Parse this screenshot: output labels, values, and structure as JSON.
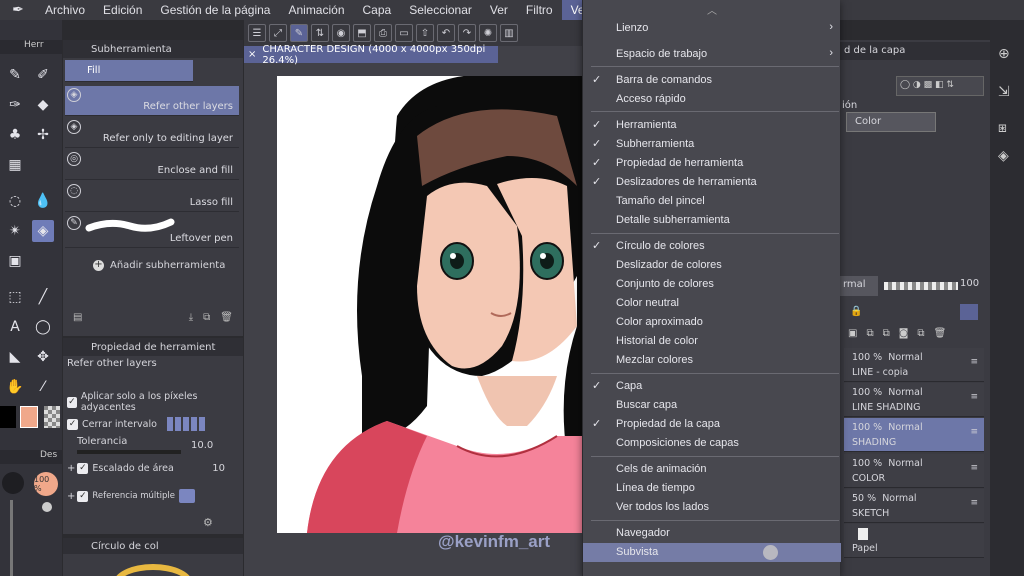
{
  "menubar": {
    "items": [
      "Archivo",
      "Edición",
      "Gestión de la página",
      "Animación",
      "Capa",
      "Seleccionar",
      "Ver",
      "Filtro",
      "Ventana"
    ]
  },
  "document_tab": "CHARACTER DESIGN (4000 x 4000px 350dpi 26.4%)",
  "subtool_panel": {
    "title": "Subherramienta",
    "items": [
      "Fill",
      "Refer other layers",
      "Refer only to editing layer",
      "Enclose and fill",
      "Lasso fill",
      "Leftover pen"
    ],
    "add_label": "Añadir subherramienta"
  },
  "tool_property": {
    "title": "Propiedad de herramient",
    "subtitle": "Refer other layers",
    "options": [
      "Aplicar solo a los píxeles adyacentes",
      "Cerrar intervalo"
    ],
    "tolerance_label": "Tolerancia",
    "tolerance_value": "10.0",
    "area_label": "Escalado de área",
    "area_value": "10",
    "multi_ref_label": "Referencia múltiple"
  },
  "color_panel_title": "Círculo de col",
  "zoom_badge": "100 %",
  "left_tab": "Herr",
  "left_tab2": "Des",
  "watermark": "@kevinfm_art",
  "window_menu": {
    "items": [
      {
        "label": "Lienzo",
        "arrow": "›"
      },
      {
        "label": "Espacio de trabajo",
        "arrow": "›"
      },
      {
        "label": "Barra de comandos",
        "check": true
      },
      {
        "label": "Acceso rápido"
      },
      {
        "label": "Herramienta",
        "check": true
      },
      {
        "label": "Subherramienta",
        "check": true
      },
      {
        "label": "Propiedad de herramienta",
        "check": true
      },
      {
        "label": "Deslizadores de herramienta",
        "check": true
      },
      {
        "label": "Tamaño del pincel"
      },
      {
        "label": "Detalle subherramienta"
      },
      {
        "label": "Círculo de colores",
        "check": true
      },
      {
        "label": "Deslizador de colores"
      },
      {
        "label": "Conjunto de colores"
      },
      {
        "label": "Color neutral"
      },
      {
        "label": "Color aproximado"
      },
      {
        "label": "Historial de color"
      },
      {
        "label": "Mezclar colores"
      },
      {
        "label": "Capa",
        "check": true
      },
      {
        "label": "Buscar capa"
      },
      {
        "label": "Propiedad de la capa",
        "check": true
      },
      {
        "label": "Composiciones de capas"
      },
      {
        "label": "Cels de animación"
      },
      {
        "label": "Línea de tiempo"
      },
      {
        "label": "Ver todos los lados"
      },
      {
        "label": "Navegador"
      },
      {
        "label": "Subvista"
      }
    ]
  },
  "layer_property": {
    "title": "d de la capa",
    "label": "ión",
    "color_select": "Color"
  },
  "layer_panel": {
    "blend_mode": "rmal",
    "opacity": "100",
    "layers": [
      {
        "opacity": "100 %",
        "mode": "Normal",
        "name": "LINE - copia"
      },
      {
        "opacity": "100 %",
        "mode": "Normal",
        "name": "LINE SHADING"
      },
      {
        "opacity": "100 %",
        "mode": "Normal",
        "name": "SHADING"
      },
      {
        "opacity": "100 %",
        "mode": "Normal",
        "name": "COLOR"
      },
      {
        "opacity": "50 %",
        "mode": "Normal",
        "name": "SKETCH"
      },
      {
        "opacity": "",
        "mode": "",
        "name": "Papel"
      }
    ]
  },
  "colors": {
    "accent": "#5b6396",
    "menu_bg": "#48484f",
    "fg_swatch": "#000000",
    "bg_swatch": "#f0a88a"
  }
}
